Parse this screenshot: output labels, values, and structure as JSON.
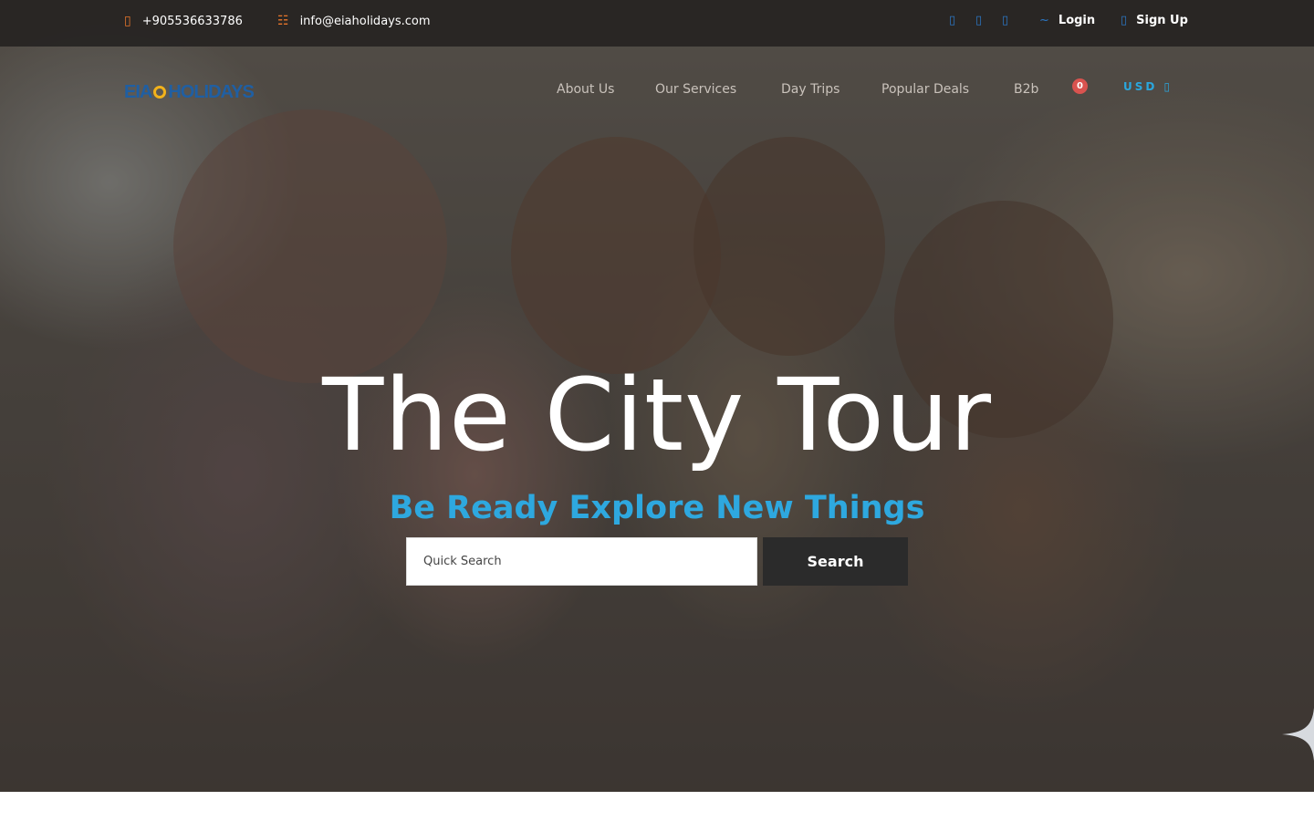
{
  "topbar": {
    "phone": "+905536633786",
    "email": "info@eiaholidays.com",
    "login_label": "Login",
    "signup_label": "Sign Up"
  },
  "brand": {
    "logo_text_left": "EIA",
    "logo_text_right": "HOLIDAYS"
  },
  "nav": {
    "items": [
      "About Us",
      "Our Services",
      "Day Trips",
      "Popular Deals",
      "B2b"
    ],
    "cart_count": "0",
    "currency": "USD"
  },
  "hero": {
    "title": "The City Tour",
    "subtitle": "Be Ready Explore New Things"
  },
  "search": {
    "placeholder": "Quick Search",
    "button_label": "Search"
  },
  "colors": {
    "accent": "#2ea8df",
    "topbar_bg": "#232120",
    "icon_orange": "#e8762b",
    "badge_red": "#d9534f"
  },
  "icons": [
    "phone-icon",
    "envelope-icon",
    "facebook-icon",
    "twitter-icon",
    "instagram-icon",
    "tilde-icon",
    "user-icon",
    "caret-down-icon",
    "star-sparkle-icon"
  ]
}
